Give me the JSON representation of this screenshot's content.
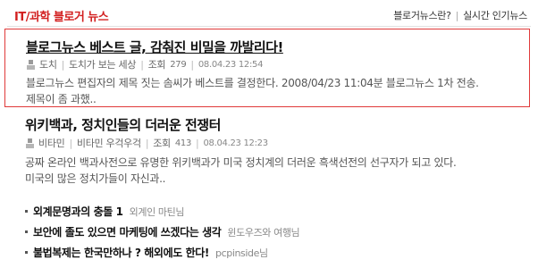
{
  "header": {
    "title": "IT/과학 블로거 뉴스",
    "link_blog_news": "블로거뉴스란?",
    "link_popular": "실시간 인기뉴스"
  },
  "posts": [
    {
      "title": "블로그뉴스 베스트 글, 감춰진 비밀을 까발리다!",
      "author": "도치",
      "blog": "도치가 보는 세상",
      "views_label": "조회",
      "views": "279",
      "date": "08.04.23 12:54",
      "summary_line1": "블로그뉴스 편집자의 제목 짓는 솜씨가 베스트를 결정한다. 2008/04/23 11:04분 블로그뉴스 1차 전송.",
      "summary_line2": "제목이 좀 과했.."
    },
    {
      "title": "위키백과, 정치인들의 더러운 전쟁터",
      "author": "비타민",
      "blog": "비타민 우걱우걱",
      "views_label": "조회",
      "views": "413",
      "date": "08.04.23 12:23",
      "summary_line1": "공짜 온라인 백과사전으로 유명한 위키백과가 미국 정치계의 더러운 흑색선전의 선구자가 되고 있다.",
      "summary_line2": "미국의 많은 정치가들이 자신과.."
    }
  ],
  "minilist": [
    {
      "title": "외계문명과의 충돌 1",
      "author": "외계인 마틴님"
    },
    {
      "title": "보안에 졸도 있으면 마케팅에 쓰겠다는 생각",
      "author": "윈도우즈와 여행님"
    },
    {
      "title": "불법복제는 한국만하나 ? 해외에도 한다!",
      "author": "pcpinside님"
    }
  ],
  "colors": {
    "header_title": "#d21f1f",
    "featured_border": "#e03a3a"
  }
}
